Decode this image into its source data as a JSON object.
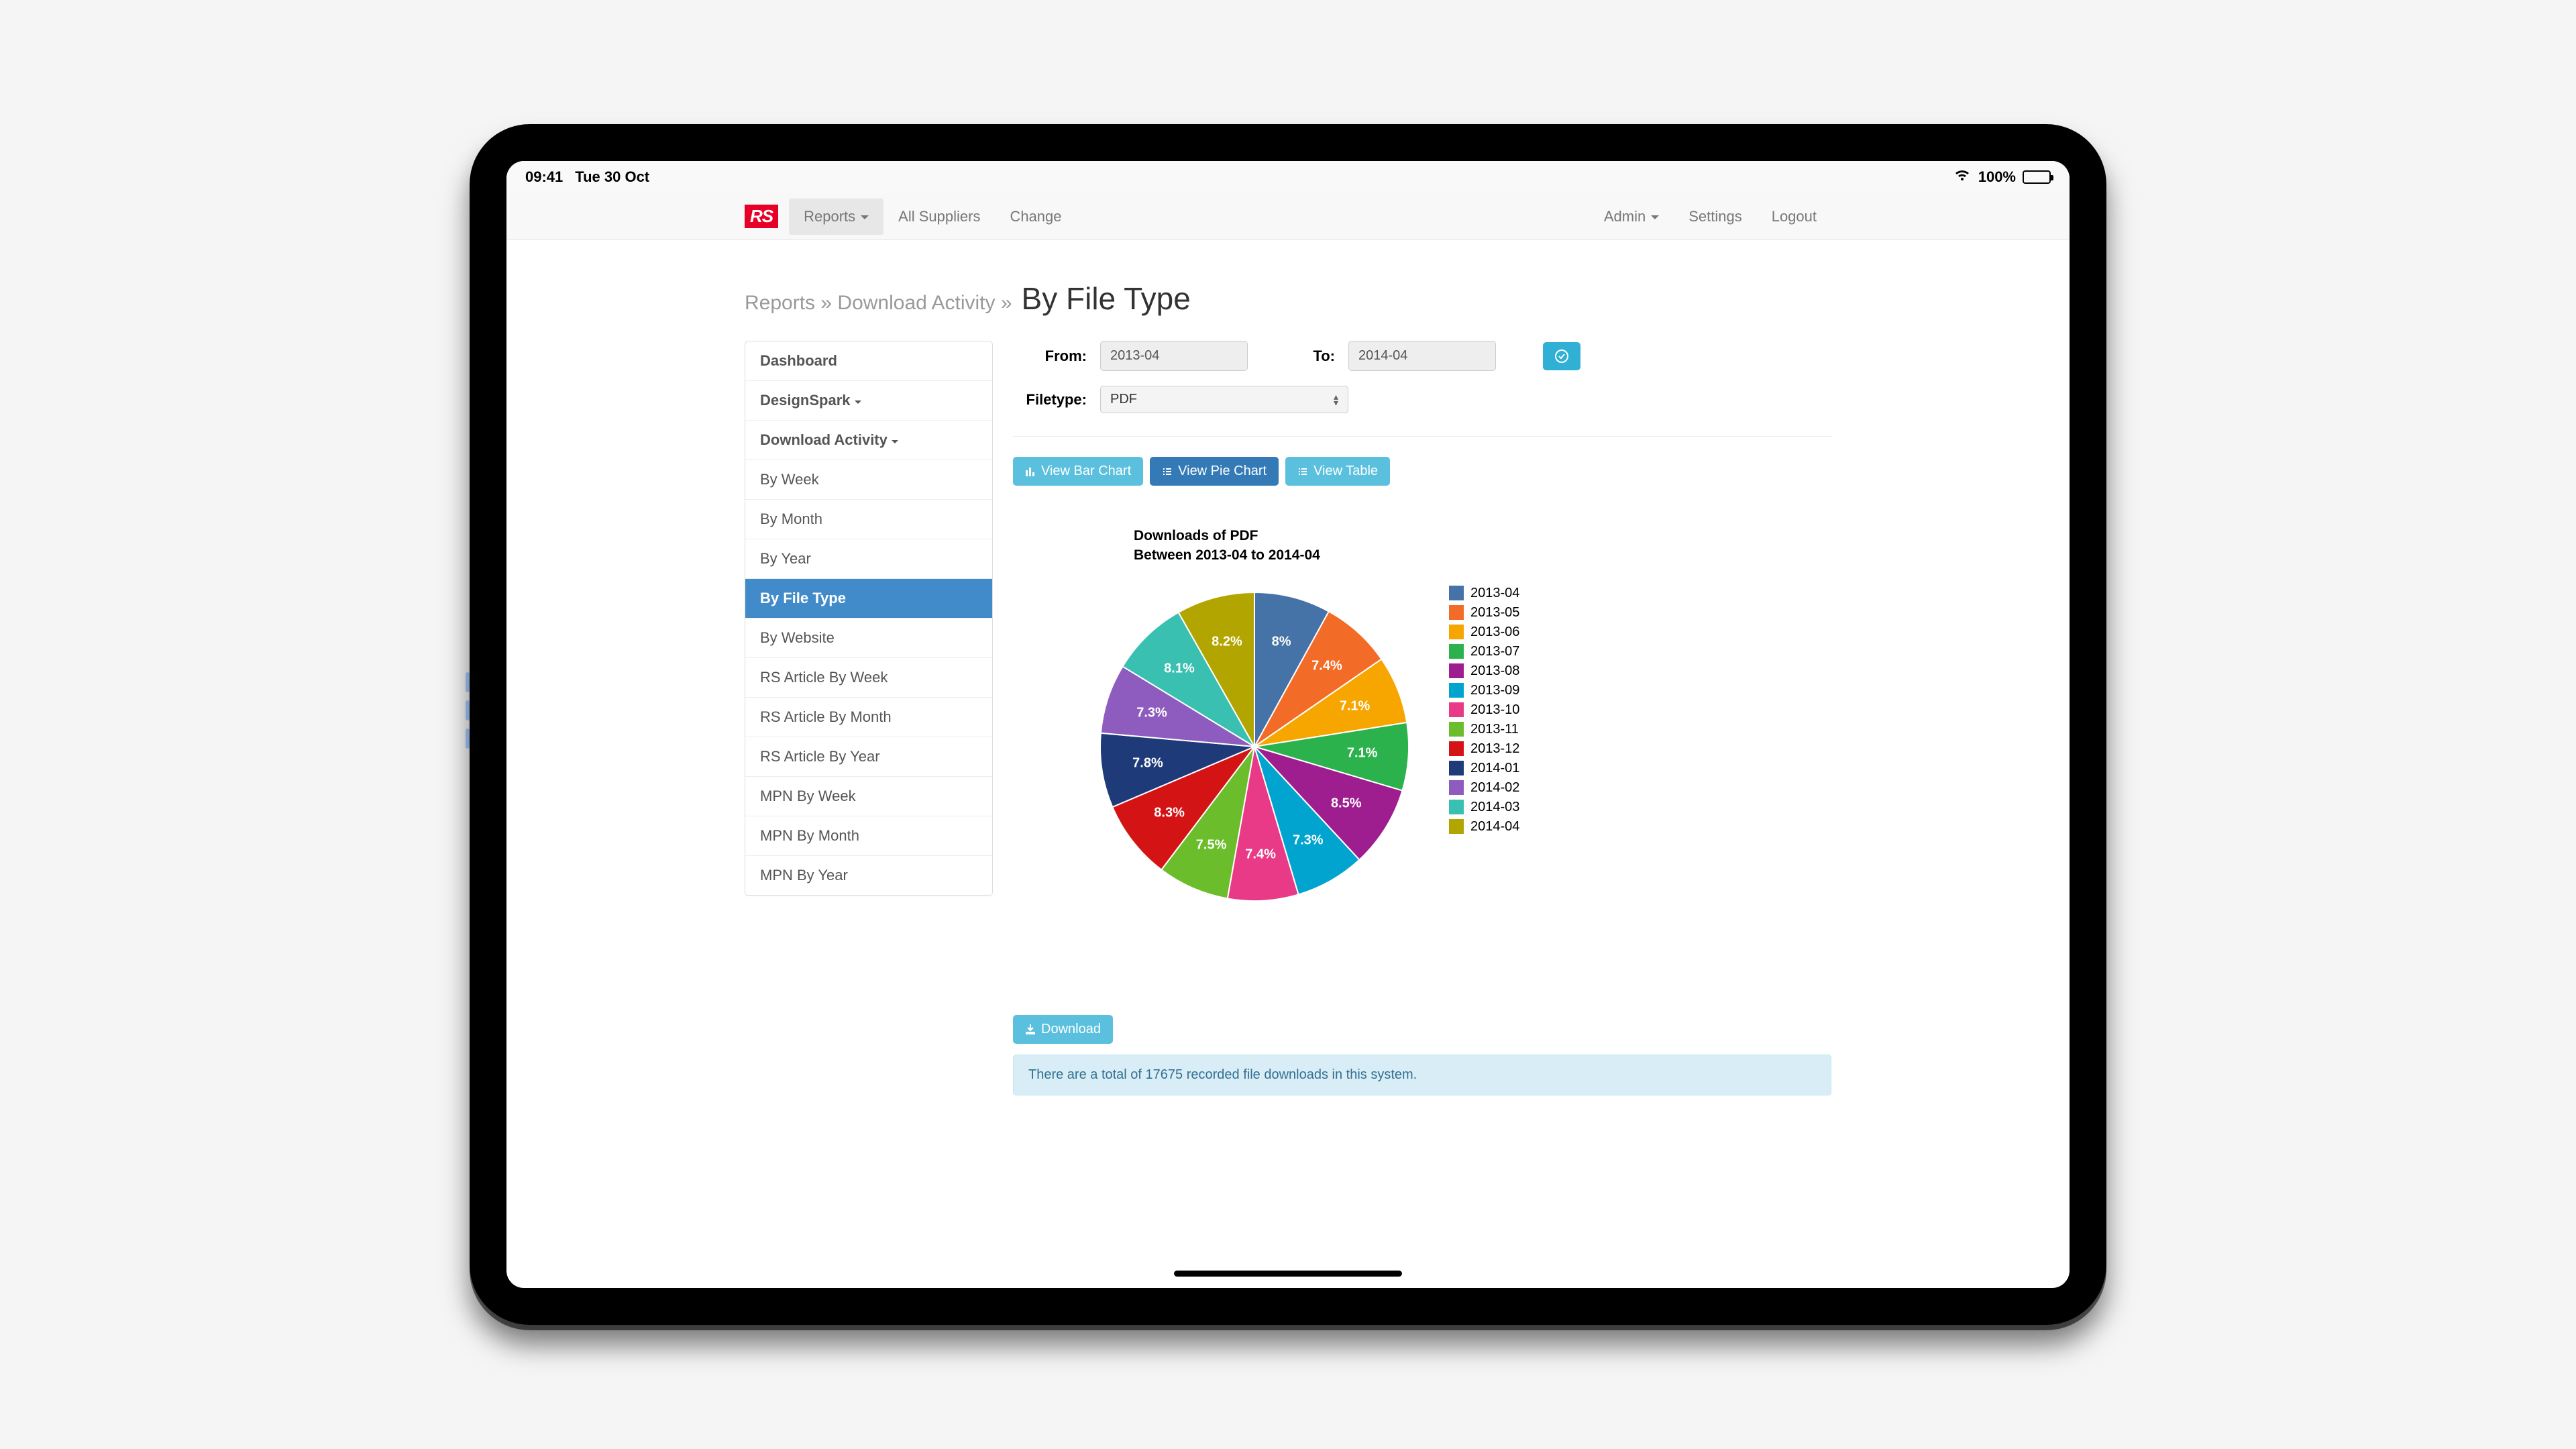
{
  "status": {
    "time": "09:41",
    "date": "Tue 30 Oct",
    "battery": "100%"
  },
  "brand": "RS",
  "nav": {
    "reports": "Reports",
    "all_suppliers": "All Suppliers",
    "change": "Change",
    "admin": "Admin",
    "settings": "Settings",
    "logout": "Logout"
  },
  "breadcrumb": {
    "reports": "Reports",
    "download": "Download Activity"
  },
  "page_title": "By File Type",
  "sidebar": {
    "dashboard": "Dashboard",
    "designspark": "DesignSpark",
    "download_activity": "Download Activity",
    "items": [
      "By Week",
      "By Month",
      "By Year",
      "By File Type",
      "By Website",
      "RS Article By Week",
      "RS Article By Month",
      "RS Article By Year",
      "MPN By Week",
      "MPN By Month",
      "MPN By Year"
    ]
  },
  "filters": {
    "from_label": "From:",
    "from_value": "2013-04",
    "to_label": "To:",
    "to_value": "2014-04",
    "filetype_label": "Filetype:",
    "filetype_value": "PDF"
  },
  "buttons": {
    "bar": "View Bar Chart",
    "pie": "View Pie Chart",
    "table": "View Table",
    "download": "Download"
  },
  "info": "There are a total of 17675 recorded file downloads in this system.",
  "chart_data": {
    "type": "pie",
    "title": "Downloads of PDF",
    "subtitle": "Between 2013-04 to 2014-04",
    "series": [
      {
        "name": "2013-04",
        "value": 8.0,
        "label": "8%",
        "color": "#4572a7"
      },
      {
        "name": "2013-05",
        "value": 7.4,
        "label": "7.4%",
        "color": "#f26c28"
      },
      {
        "name": "2013-06",
        "value": 7.1,
        "label": "7.1%",
        "color": "#f7a600"
      },
      {
        "name": "2013-07",
        "value": 7.1,
        "label": "7.1%",
        "color": "#2bb24c"
      },
      {
        "name": "2013-08",
        "value": 8.5,
        "label": "8.5%",
        "color": "#9e1d8f"
      },
      {
        "name": "2013-09",
        "value": 7.3,
        "label": "7.3%",
        "color": "#00a4cf"
      },
      {
        "name": "2013-10",
        "value": 7.4,
        "label": "7.4%",
        "color": "#e83a87"
      },
      {
        "name": "2013-11",
        "value": 7.5,
        "label": "7.5%",
        "color": "#6bbd2b"
      },
      {
        "name": "2013-12",
        "value": 8.3,
        "label": "8.3%",
        "color": "#d41414"
      },
      {
        "name": "2014-01",
        "value": 7.8,
        "label": "7.8%",
        "color": "#1f3a78"
      },
      {
        "name": "2014-02",
        "value": 7.3,
        "label": "7.3%",
        "color": "#8e5bbf"
      },
      {
        "name": "2014-03",
        "value": 8.1,
        "label": "8.1%",
        "color": "#3ac0b0"
      },
      {
        "name": "2014-04",
        "value": 8.2,
        "label": "8.2%",
        "color": "#b3a500"
      }
    ]
  }
}
